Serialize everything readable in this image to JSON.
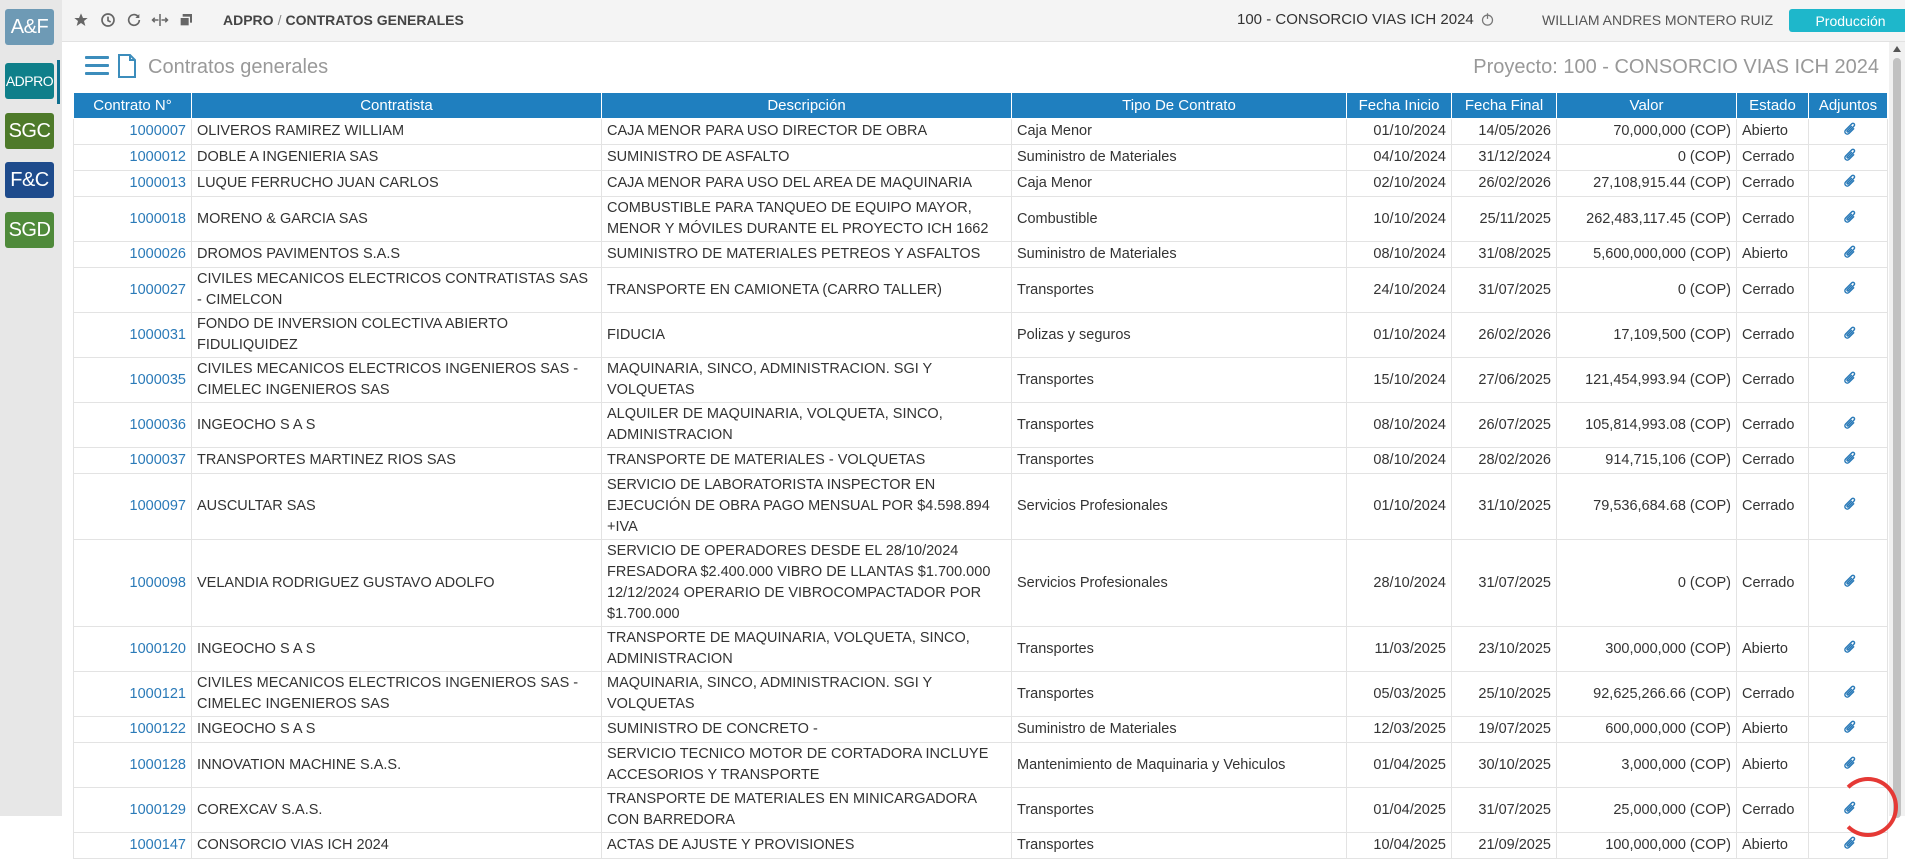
{
  "sidebar": {
    "apps": [
      {
        "label": "A&F",
        "color": "#6e9ab5"
      },
      {
        "label": "ADPRO",
        "color": "#0f7f8a"
      },
      {
        "label": "SGC",
        "color": "#4e7a2a"
      },
      {
        "label": "F&C",
        "color": "#1e4b8c"
      },
      {
        "label": "SGD",
        "color": "#4f8a3a"
      }
    ]
  },
  "topbar": {
    "breadcrumb_module": "ADPRO",
    "breadcrumb_sep": "/",
    "breadcrumb_page": "CONTRATOS GENERALES",
    "project": "100 - CONSORCIO VIAS ICH 2024",
    "user": "WILLIAM ANDRES MONTERO RUIZ",
    "environment": "Producción"
  },
  "header": {
    "title": "Contratos generales",
    "project_label": "Proyecto: 100 - CONSORCIO VIAS ICH 2024"
  },
  "table": {
    "columns": [
      "Contrato N°",
      "Contratista",
      "Descripción",
      "Tipo De Contrato",
      "Fecha Inicio",
      "Fecha Final",
      "Valor",
      "Estado",
      "Adjuntos"
    ],
    "rows": [
      {
        "id": "1000007",
        "contratista": "OLIVEROS RAMIREZ WILLIAM",
        "descripcion": "CAJA MENOR PARA USO DIRECTOR DE OBRA",
        "tipo": "Caja Menor",
        "inicio": "01/10/2024",
        "final": "14/05/2026",
        "valor": "70,000,000 (COP)",
        "estado": "Abierto"
      },
      {
        "id": "1000012",
        "contratista": "DOBLE A INGENIERIA SAS",
        "descripcion": "SUMINISTRO DE ASFALTO",
        "tipo": "Suministro de Materiales",
        "inicio": "04/10/2024",
        "final": "31/12/2024",
        "valor": "0 (COP)",
        "estado": "Cerrado"
      },
      {
        "id": "1000013",
        "contratista": "LUQUE FERRUCHO JUAN CARLOS",
        "descripcion": "CAJA MENOR PARA USO DEL AREA DE MAQUINARIA",
        "tipo": "Caja Menor",
        "inicio": "02/10/2024",
        "final": "26/02/2026",
        "valor": "27,108,915.44 (COP)",
        "estado": "Cerrado"
      },
      {
        "id": "1000018",
        "contratista": "MORENO & GARCIA SAS",
        "descripcion": "COMBUSTIBLE PARA TANQUEO DE EQUIPO MAYOR, MENOR Y MÓVILES DURANTE EL PROYECTO ICH 1662",
        "tipo": "Combustible",
        "inicio": "10/10/2024",
        "final": "25/11/2025",
        "valor": "262,483,117.45 (COP)",
        "estado": "Cerrado"
      },
      {
        "id": "1000026",
        "contratista": "DROMOS PAVIMENTOS S.A.S",
        "descripcion": "SUMINISTRO DE MATERIALES PETREOS Y ASFALTOS",
        "tipo": "Suministro de Materiales",
        "inicio": "08/10/2024",
        "final": "31/08/2025",
        "valor": "5,600,000,000 (COP)",
        "estado": "Abierto"
      },
      {
        "id": "1000027",
        "contratista": "CIVILES MECANICOS ELECTRICOS CONTRATISTAS SAS - CIMELCON",
        "descripcion": "TRANSPORTE EN CAMIONETA (CARRO TALLER)",
        "tipo": "Transportes",
        "inicio": "24/10/2024",
        "final": "31/07/2025",
        "valor": "0 (COP)",
        "estado": "Cerrado"
      },
      {
        "id": "1000031",
        "contratista": "FONDO DE INVERSION COLECTIVA ABIERTO FIDULIQUIDEZ",
        "descripcion": "FIDUCIA",
        "tipo": "Polizas y seguros",
        "inicio": "01/10/2024",
        "final": "26/02/2026",
        "valor": "17,109,500 (COP)",
        "estado": "Cerrado"
      },
      {
        "id": "1000035",
        "contratista": "CIVILES MECANICOS ELECTRICOS INGENIEROS SAS - CIMELEC INGENIEROS SAS",
        "descripcion": "MAQUINARIA, SINCO, ADMINISTRACION. SGI Y VOLQUETAS",
        "tipo": "Transportes",
        "inicio": "15/10/2024",
        "final": "27/06/2025",
        "valor": "121,454,993.94 (COP)",
        "estado": "Cerrado"
      },
      {
        "id": "1000036",
        "contratista": "INGEOCHO S A S",
        "descripcion": "ALQUILER DE MAQUINARIA, VOLQUETA, SINCO, ADMINISTRACION",
        "tipo": "Transportes",
        "inicio": "08/10/2024",
        "final": "26/07/2025",
        "valor": "105,814,993.08 (COP)",
        "estado": "Cerrado"
      },
      {
        "id": "1000037",
        "contratista": "TRANSPORTES MARTINEZ RIOS SAS",
        "descripcion": "TRANSPORTE DE MATERIALES - VOLQUETAS",
        "tipo": "Transportes",
        "inicio": "08/10/2024",
        "final": "28/02/2026",
        "valor": "914,715,106 (COP)",
        "estado": "Cerrado"
      },
      {
        "id": "1000097",
        "contratista": "AUSCULTAR SAS",
        "descripcion": "SERVICIO DE LABORATORISTA INSPECTOR EN EJECUCIÓN DE OBRA PAGO MENSUAL POR $4.598.894 +IVA",
        "tipo": "Servicios Profesionales",
        "inicio": "01/10/2024",
        "final": "31/10/2025",
        "valor": "79,536,684.68 (COP)",
        "estado": "Cerrado"
      },
      {
        "id": "1000098",
        "contratista": "VELANDIA RODRIGUEZ GUSTAVO ADOLFO",
        "descripcion": "SERVICIO DE OPERADORES DESDE EL 28/10/2024 FRESADORA $2.400.000 VIBRO DE LLANTAS $1.700.000 12/12/2024 OPERARIO DE VIBROCOMPACTADOR POR $1.700.000",
        "tipo": "Servicios Profesionales",
        "inicio": "28/10/2024",
        "final": "31/07/2025",
        "valor": "0 (COP)",
        "estado": "Cerrado"
      },
      {
        "id": "1000120",
        "contratista": "INGEOCHO S A S",
        "descripcion": "TRANSPORTE DE MAQUINARIA, VOLQUETA, SINCO, ADMINISTRACION",
        "tipo": "Transportes",
        "inicio": "11/03/2025",
        "final": "23/10/2025",
        "valor": "300,000,000 (COP)",
        "estado": "Abierto"
      },
      {
        "id": "1000121",
        "contratista": "CIVILES MECANICOS ELECTRICOS INGENIEROS SAS - CIMELEC INGENIEROS SAS",
        "descripcion": "MAQUINARIA, SINCO, ADMINISTRACION. SGI Y VOLQUETAS",
        "tipo": "Transportes",
        "inicio": "05/03/2025",
        "final": "25/10/2025",
        "valor": "92,625,266.66 (COP)",
        "estado": "Cerrado"
      },
      {
        "id": "1000122",
        "contratista": "INGEOCHO S A S",
        "descripcion": "SUMINISTRO DE CONCRETO -",
        "tipo": "Suministro de Materiales",
        "inicio": "12/03/2025",
        "final": "19/07/2025",
        "valor": "600,000,000 (COP)",
        "estado": "Abierto"
      },
      {
        "id": "1000128",
        "contratista": "INNOVATION MACHINE S.A.S.",
        "descripcion": "SERVICIO TECNICO MOTOR DE CORTADORA INCLUYE ACCESORIOS Y TRANSPORTE",
        "tipo": "Mantenimiento de Maquinaria y Vehiculos",
        "inicio": "01/04/2025",
        "final": "30/10/2025",
        "valor": "3,000,000 (COP)",
        "estado": "Abierto"
      },
      {
        "id": "1000129",
        "contratista": "COREXCAV S.A.S.",
        "descripcion": "TRANSPORTE DE MATERIALES EN MINICARGADORA CON BARREDORA",
        "tipo": "Transportes",
        "inicio": "01/04/2025",
        "final": "31/07/2025",
        "valor": "25,000,000 (COP)",
        "estado": "Cerrado"
      },
      {
        "id": "1000147",
        "contratista": "CONSORCIO VIAS ICH 2024",
        "descripcion": "ACTAS DE AJUSTE Y PROVISIONES",
        "tipo": "Transportes",
        "inicio": "10/04/2025",
        "final": "21/09/2025",
        "valor": "100,000,000 (COP)",
        "estado": "Abierto"
      }
    ]
  },
  "colors": {
    "accent": "#1f7fbf",
    "badge": "#1eb7cb",
    "link": "#2a7ab8"
  },
  "icons": [
    "star-icon",
    "history-icon",
    "refresh-icon",
    "split-icon",
    "window-icon",
    "menu-icon",
    "document-icon",
    "paperclip-icon",
    "power-icon"
  ]
}
